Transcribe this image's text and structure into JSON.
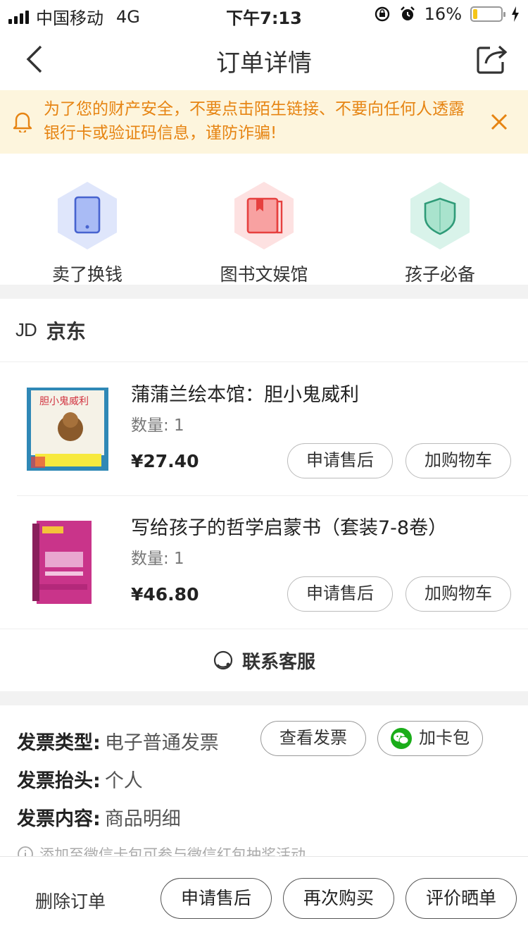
{
  "status_bar": {
    "carrier": "中国移动",
    "network": "4G",
    "time": "下午7:13",
    "battery_percent": "16%",
    "battery_level": 0.16
  },
  "nav": {
    "title": "订单详情"
  },
  "notice": {
    "text": "为了您的财产安全，不要点击陌生链接、不要向任何人透露银行卡或验证码信息，谨防诈骗!"
  },
  "quick_links": [
    {
      "label": "卖了换钱",
      "icon": "tablet-icon",
      "color": "#dfe6fb"
    },
    {
      "label": "图书文娱馆",
      "icon": "book-icon",
      "color": "#fde1e1"
    },
    {
      "label": "孩子必备",
      "icon": "shield-icon",
      "color": "#d9f3ea"
    }
  ],
  "store": {
    "logo": "JD",
    "name": "京东",
    "products": [
      {
        "title": "蒲蒲兰绘本馆：胆小鬼威利",
        "qty": "数量: 1",
        "price": "¥27.40",
        "after_sale": "申请售后",
        "add_cart": "加购物车"
      },
      {
        "title": "写给孩子的哲学启蒙书（套装7-8卷）",
        "qty": "数量: 1",
        "price": "¥46.80",
        "after_sale": "申请售后",
        "add_cart": "加购物车"
      }
    ],
    "service_label": "联系客服"
  },
  "invoice": {
    "type_key": "发票类型:",
    "type_value": "电子普通发票",
    "view_btn": "查看发票",
    "wallet_btn": "加卡包",
    "title_key": "发票抬头:",
    "title_value": "个人",
    "content_key": "发票内容:",
    "content_value": "商品明细",
    "tip": "添加至微信卡包可参与微信红包抽奖活动"
  },
  "bottom_bar": {
    "delete": "删除订单",
    "after_sale": "申请售后",
    "rebuy": "再次购买",
    "review": "评价晒单"
  },
  "colors": {
    "notice_text": "#e68412",
    "notice_bg": "#fdf5dd",
    "wechat_green": "#1aad19"
  }
}
